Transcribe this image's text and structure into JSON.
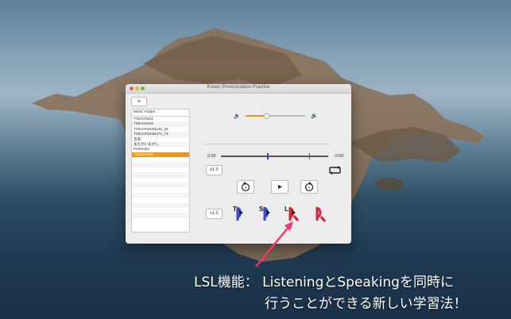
{
  "window": {
    "title": "Kosen Pronunciation Practice",
    "add_label": "+",
    "list_header": "Music Folder",
    "list_items": [
      "TOEICPart1",
      "TOEICPart2",
      "TOEICPart3No32_34",
      "TOEICPart4No71_73",
      "音楽",
      "またがいまがし",
      "Pretender",
      "TOEICPart5"
    ],
    "selected_index": 7
  },
  "player": {
    "volume_level": 0.35,
    "time_elapsed": "0:02",
    "time_remaining": "-0:00",
    "speed_label_1": "x1.0",
    "speed_label_2": "x1.0",
    "markers": [
      0.43,
      0.82
    ],
    "icon_letters": [
      "T",
      "S",
      "L"
    ]
  },
  "caption": {
    "line1": "LSL機能： ListeningとSpeakingを同時に",
    "line2": "行うことができる新しい学習法！"
  },
  "colors": {
    "accent": "#e59a1f",
    "icon_blue": "#3a47c8",
    "icon_red": "#d8222f",
    "arrow": "#f2366f"
  }
}
